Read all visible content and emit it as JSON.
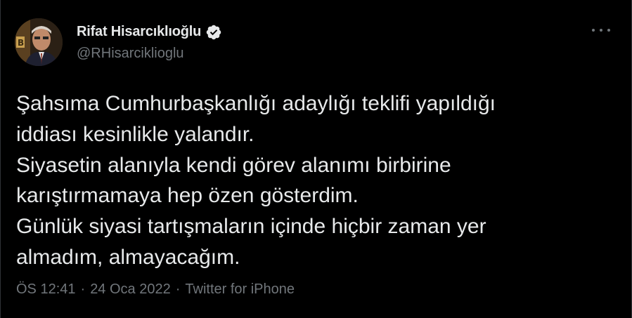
{
  "author": {
    "display_name": "Rifat Hisarcıklıoğlu",
    "handle": "@RHisarciklioglu",
    "verified": true,
    "avatar_icon": "profile-photo"
  },
  "tweet": {
    "text": "Şahsıma Cumhurbaşkanlığı adaylığı teklifi yapıldığı\niddiası kesinlikle yalandır.\nSiyasetin alanıyla kendi görev alanımı birbirine\nkarıştırmamaya hep özen gösterdim.\nGünlük siyasi tartışmaların içinde hiçbir zaman yer\nalmadım, almayacağım."
  },
  "meta": {
    "time": "ÖS 12:41",
    "separator": "·",
    "date": "24 Oca 2022",
    "source": "Twitter for iPhone"
  },
  "colors": {
    "background": "#000000",
    "primary_text": "#e7e9ea",
    "secondary_text": "#71767b",
    "verified_badge": "#e7e9ea"
  }
}
